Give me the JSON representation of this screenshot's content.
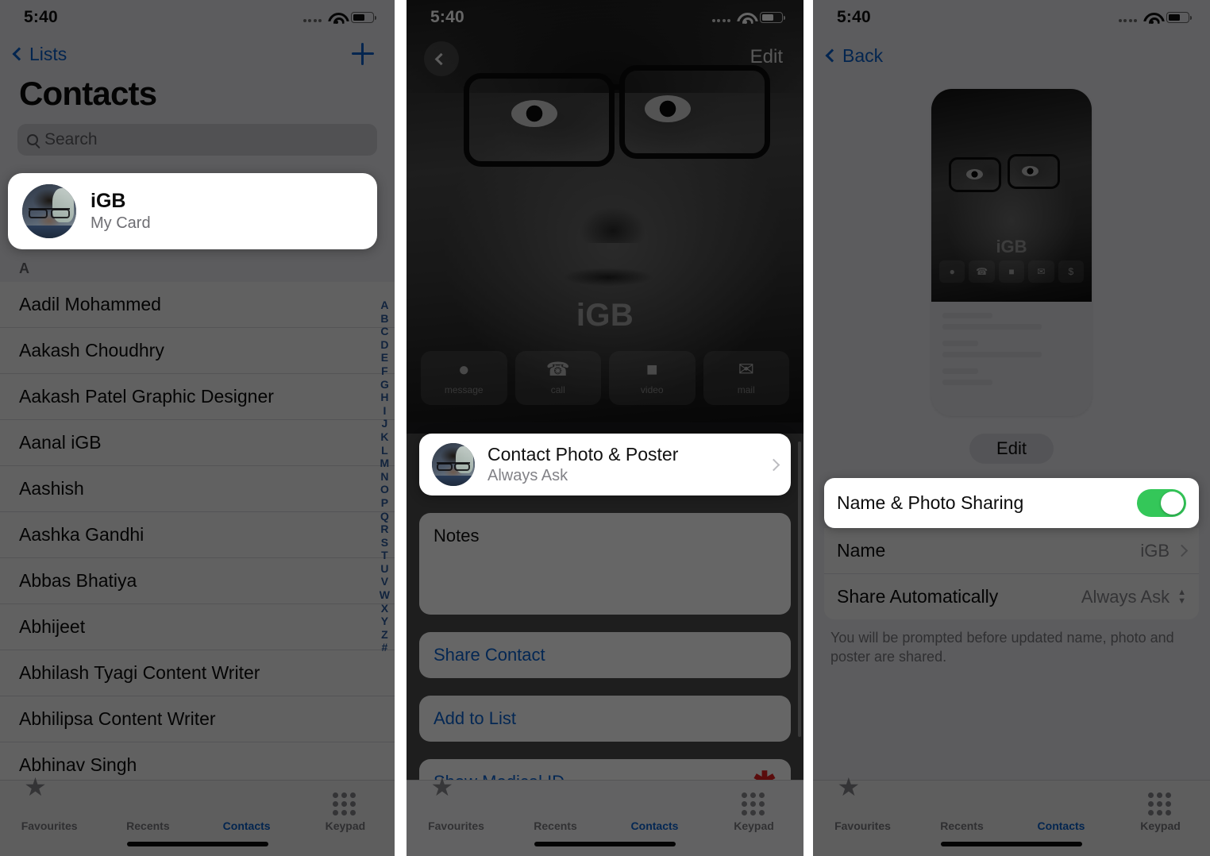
{
  "status_bar": {
    "time": "5:40",
    "wifi_icon": "wifi-icon",
    "battery_icon": "battery-icon",
    "signal_icon": "signal-dots-icon"
  },
  "panel1": {
    "nav": {
      "back_label": "Lists",
      "back_icon": "chevron-left-icon",
      "add_icon": "plus-icon"
    },
    "title": "Contacts",
    "search": {
      "placeholder": "Search",
      "icon": "search-icon"
    },
    "my_card": {
      "name": "iGB",
      "subtitle": "My Card",
      "avatar": "contact-avatar"
    },
    "section_letter": "A",
    "contacts": [
      "Aadil Mohammed",
      "Aakash Choudhry",
      "Aakash Patel Graphic Designer",
      "Aanal iGB",
      "Aashish",
      "Aashka Gandhi",
      "Abbas Bhatiya",
      "Abhijeet",
      "Abhilash Tyagi Content Writer",
      "Abhilipsa Content Writer",
      "Abhinav Singh"
    ],
    "alpha_index": [
      "A",
      "B",
      "C",
      "D",
      "E",
      "F",
      "G",
      "H",
      "I",
      "J",
      "K",
      "L",
      "M",
      "N",
      "O",
      "P",
      "Q",
      "R",
      "S",
      "T",
      "U",
      "V",
      "W",
      "X",
      "Y",
      "Z",
      "#"
    ]
  },
  "panel2": {
    "nav": {
      "back_icon": "chevron-left-icon",
      "edit_label": "Edit"
    },
    "poster_name": "iGB",
    "actions": [
      {
        "label": "message",
        "icon": "message-icon",
        "glyph": "●"
      },
      {
        "label": "call",
        "icon": "phone-icon",
        "glyph": "☎"
      },
      {
        "label": "video",
        "icon": "video-icon",
        "glyph": "■"
      },
      {
        "label": "mail",
        "icon": "mail-icon",
        "glyph": "✉"
      }
    ],
    "photo_poster_card": {
      "title": "Contact Photo & Poster",
      "subtitle": "Always Ask",
      "avatar": "contact-avatar",
      "chevron": "chevron-right-icon"
    },
    "rows": {
      "notes": "Notes",
      "share_contact": "Share Contact",
      "add_to_list": "Add to List",
      "show_medical_id": "Show Medical ID",
      "medical_icon": "medical-asterisk-icon"
    }
  },
  "panel3": {
    "nav": {
      "back_label": "Back",
      "back_icon": "chevron-left-icon"
    },
    "preview": {
      "name": "iGB",
      "icons": [
        "message-icon",
        "phone-icon",
        "video-icon",
        "mail-icon",
        "cash-icon"
      ],
      "glyphs": [
        "●",
        "☎",
        "■",
        "✉",
        "$"
      ]
    },
    "edit_label": "Edit",
    "toggle_row": {
      "label": "Name & Photo Sharing",
      "state": "on",
      "color": "#34C759"
    },
    "rows": [
      {
        "label": "Name",
        "value": "iGB",
        "accessory": "chevron-right-icon"
      },
      {
        "label": "Share Automatically",
        "value": "Always Ask",
        "accessory": "up-down-chevron-icon"
      }
    ],
    "footnote": "You will be prompted before updated name, photo and poster are shared."
  },
  "tabbar": {
    "tabs": [
      {
        "label": "Favourites",
        "icon": "star-icon",
        "active": false
      },
      {
        "label": "Recents",
        "icon": "clock-icon",
        "active": false
      },
      {
        "label": "Contacts",
        "icon": "person-icon",
        "active": true
      },
      {
        "label": "Keypad",
        "icon": "keypad-icon",
        "active": false
      }
    ]
  }
}
